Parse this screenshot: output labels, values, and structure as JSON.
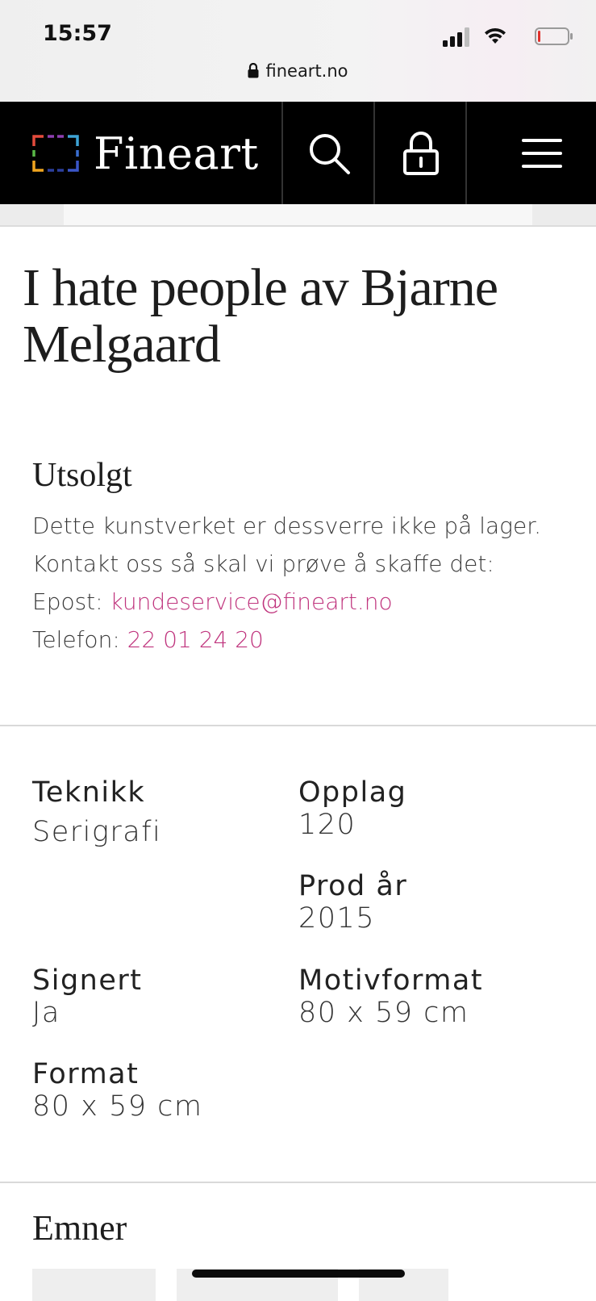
{
  "status_bar": {
    "time": "15:57",
    "icons": [
      "signal-icon",
      "wifi-icon",
      "battery-icon"
    ]
  },
  "browser": {
    "url": "fineart.no",
    "url_icon": "lock-icon"
  },
  "header": {
    "logo_text": "Fineart",
    "icons": [
      "search-icon",
      "lock-icon",
      "hamburger-menu-icon"
    ],
    "background": "#000000"
  },
  "title": "I hate people av Bjarne Melgaard",
  "sold_out": {
    "heading": "Utsolgt",
    "line1": "Dette kunstverket er dessverre ikke på lager.",
    "line2": "Kontakt oss så skal vi prøve å skaffe det:",
    "email_label": "Epost: ",
    "email": "kundeservice@fineart.no",
    "phone_label": "Telefon: ",
    "phone": "22 01 24 20",
    "link_color": "#c0357e"
  },
  "specs": {
    "teknikk": {
      "label": "Teknikk",
      "value": "Serigrafi"
    },
    "opplag": {
      "label": "Opplag",
      "value": "120"
    },
    "prod_ar": {
      "label": "Prod år",
      "value": "2015"
    },
    "signert": {
      "label": "Signert",
      "value": "Ja"
    },
    "motivformat": {
      "label": "Motivformat",
      "value": "80 x 59 cm"
    },
    "format": {
      "label": "Format",
      "value": "80 x 59 cm"
    }
  },
  "topics": {
    "heading": "Emner"
  }
}
